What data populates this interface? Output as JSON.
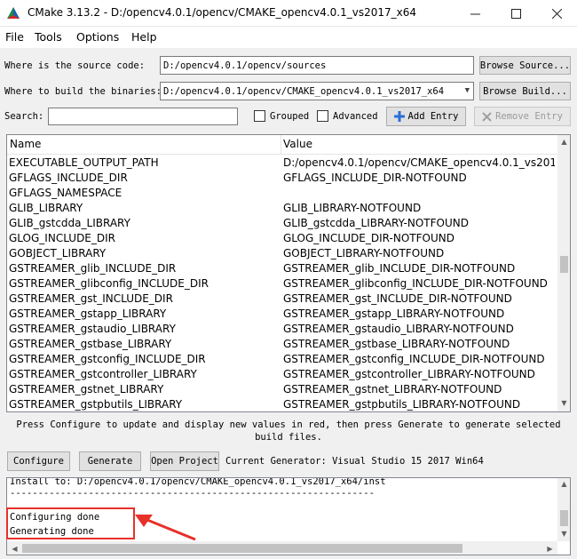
{
  "window": {
    "title": "CMake 3.13.2 - D:/opencv4.0.1/opencv/CMAKE_opencv4.0.1_vs2017_x64"
  },
  "menu": [
    "File",
    "Tools",
    "Options",
    "Help"
  ],
  "source": {
    "label": "Where is the source code:",
    "value": "D:/opencv4.0.1/opencv/sources",
    "browse_label": "Browse Source..."
  },
  "build": {
    "label": "Where to build the binaries:",
    "value": "D:/opencv4.0.1/opencv/CMAKE_opencv4.0.1_vs2017_x64",
    "browse_label": "Browse Build..."
  },
  "search": {
    "label": "Search:",
    "value": "",
    "grouped_label": "Grouped",
    "advanced_label": "Advanced",
    "add_entry_label": "Add Entry",
    "remove_entry_label": "Remove Entry"
  },
  "table": {
    "columns": [
      "Name",
      "Value"
    ],
    "rows": [
      [
        "EXECUTABLE_OUTPUT_PATH",
        "D:/opencv4.0.1/opencv/CMAKE_opencv4.0.1_vs201..."
      ],
      [
        "GFLAGS_INCLUDE_DIR",
        "GFLAGS_INCLUDE_DIR-NOTFOUND"
      ],
      [
        "GFLAGS_NAMESPACE",
        ""
      ],
      [
        "GLIB_LIBRARY",
        "GLIB_LIBRARY-NOTFOUND"
      ],
      [
        "GLIB_gstcdda_LIBRARY",
        "GLIB_gstcdda_LIBRARY-NOTFOUND"
      ],
      [
        "GLOG_INCLUDE_DIR",
        "GLOG_INCLUDE_DIR-NOTFOUND"
      ],
      [
        "GOBJECT_LIBRARY",
        "GOBJECT_LIBRARY-NOTFOUND"
      ],
      [
        "GSTREAMER_glib_INCLUDE_DIR",
        "GSTREAMER_glib_INCLUDE_DIR-NOTFOUND"
      ],
      [
        "GSTREAMER_glibconfig_INCLUDE_DIR",
        "GSTREAMER_glibconfig_INCLUDE_DIR-NOTFOUND"
      ],
      [
        "GSTREAMER_gst_INCLUDE_DIR",
        "GSTREAMER_gst_INCLUDE_DIR-NOTFOUND"
      ],
      [
        "GSTREAMER_gstapp_LIBRARY",
        "GSTREAMER_gstapp_LIBRARY-NOTFOUND"
      ],
      [
        "GSTREAMER_gstaudio_LIBRARY",
        "GSTREAMER_gstaudio_LIBRARY-NOTFOUND"
      ],
      [
        "GSTREAMER_gstbase_LIBRARY",
        "GSTREAMER_gstbase_LIBRARY-NOTFOUND"
      ],
      [
        "GSTREAMER_gstconfig_INCLUDE_DIR",
        "GSTREAMER_gstconfig_INCLUDE_DIR-NOTFOUND"
      ],
      [
        "GSTREAMER_gstcontroller_LIBRARY",
        "GSTREAMER_gstcontroller_LIBRARY-NOTFOUND"
      ],
      [
        "GSTREAMER_gstnet_LIBRARY",
        "GSTREAMER_gstnet_LIBRARY-NOTFOUND"
      ],
      [
        "GSTREAMER_gstpbutils_LIBRARY",
        "GSTREAMER_gstpbutils_LIBRARY-NOTFOUND"
      ]
    ]
  },
  "hint": "Press Configure to update and display new values in red, then press Generate to generate selected build files.",
  "actions": {
    "configure_label": "Configure",
    "generate_label": "Generate",
    "open_project_label": "Open Project",
    "current_generator": "Current Generator: Visual Studio 15 2017 Win64"
  },
  "output": {
    "lines": [
      "  Install to:                    D:/opencv4.0.1/opencv/CMAKE_opencv4.0.1_vs2017_x64/inst",
      "-----------------------------------------------------------------",
      "",
      "Configuring done",
      "Generating done"
    ]
  },
  "colors": {
    "highlight": "#e8302a",
    "add_icon": "#2b6fd6"
  }
}
